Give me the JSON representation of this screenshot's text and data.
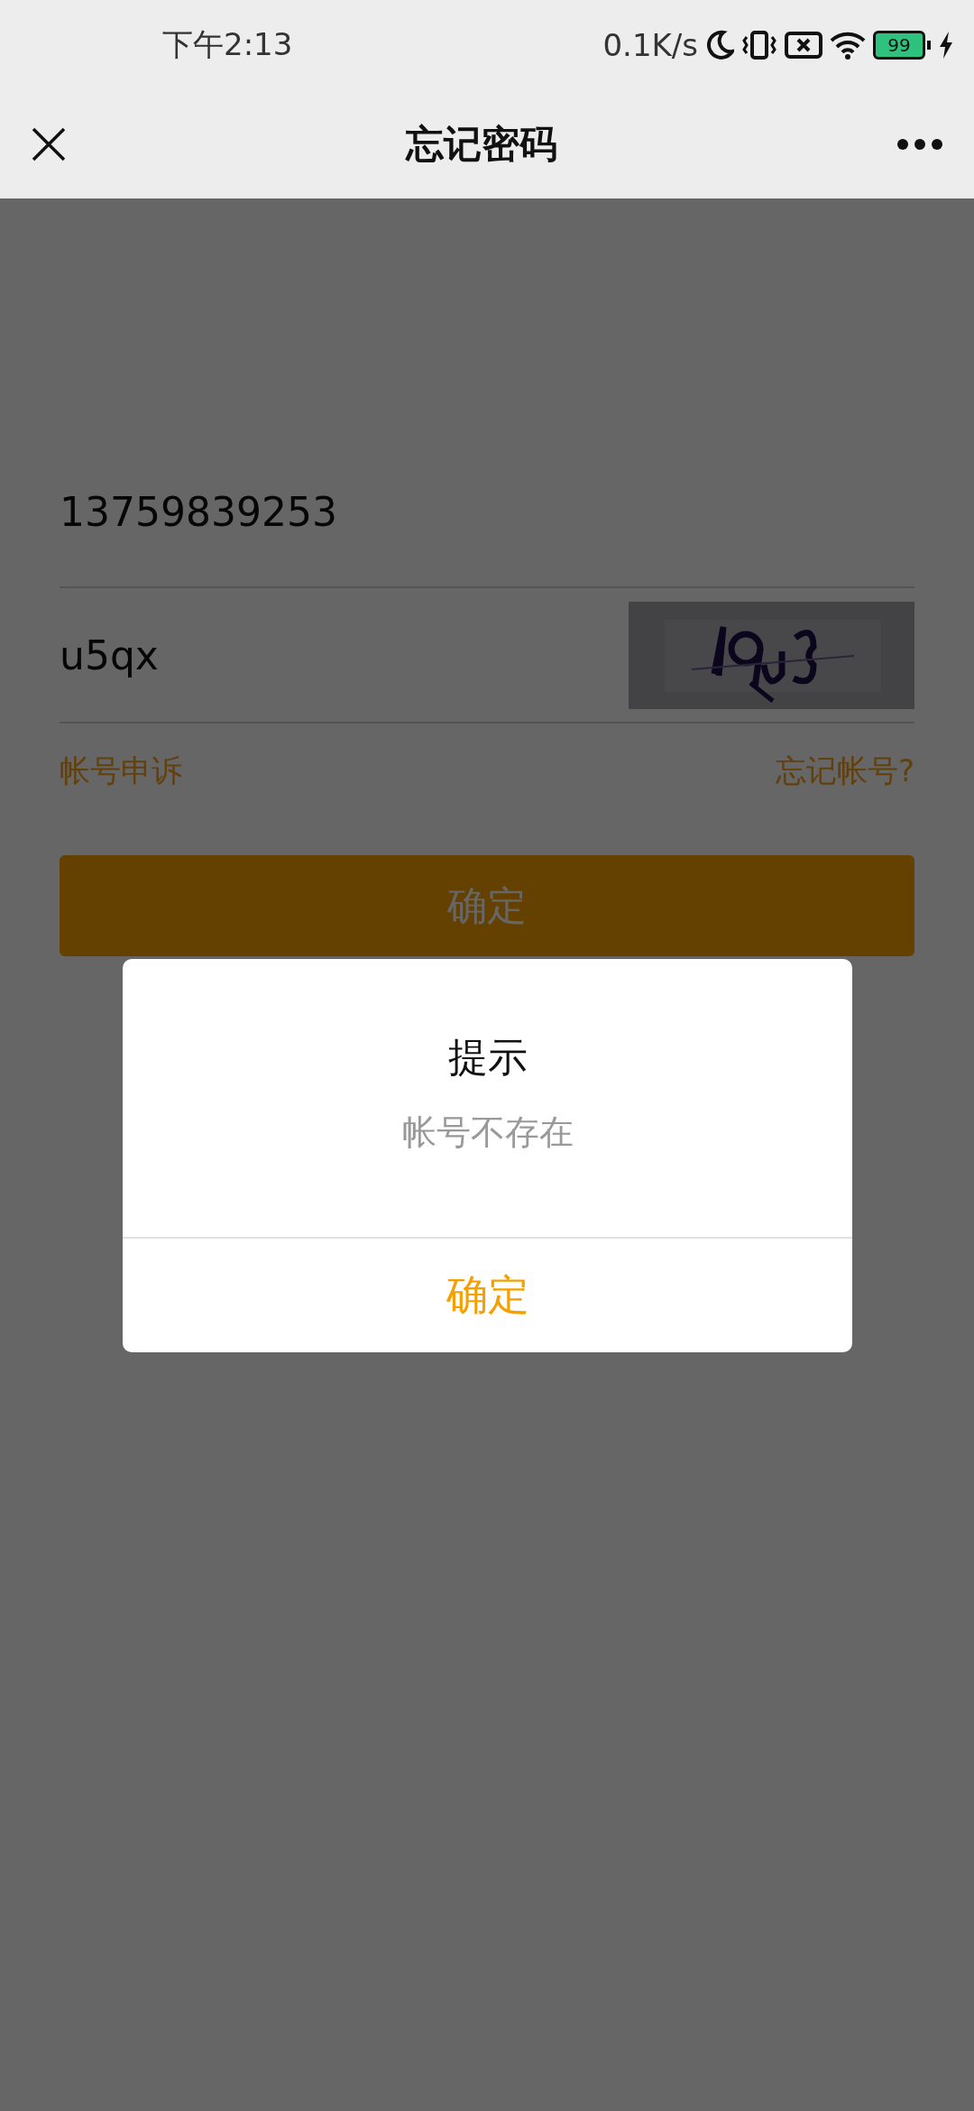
{
  "status_bar": {
    "time": "下午2:13",
    "network_speed": "0.1K/s",
    "battery_text": "99"
  },
  "nav_bar": {
    "title": "忘记密码"
  },
  "form": {
    "phone": {
      "value": "13759839253"
    },
    "captcha": {
      "value": "u5qx"
    },
    "links": [
      {
        "label": "帐号申诉"
      },
      {
        "label": "忘记帐号?"
      }
    ],
    "submit_button": {
      "label": "确定"
    }
  },
  "dialog": {
    "title": "提示",
    "message": "帐号不存在",
    "buttons": [
      {
        "label": "确定"
      }
    ]
  }
}
